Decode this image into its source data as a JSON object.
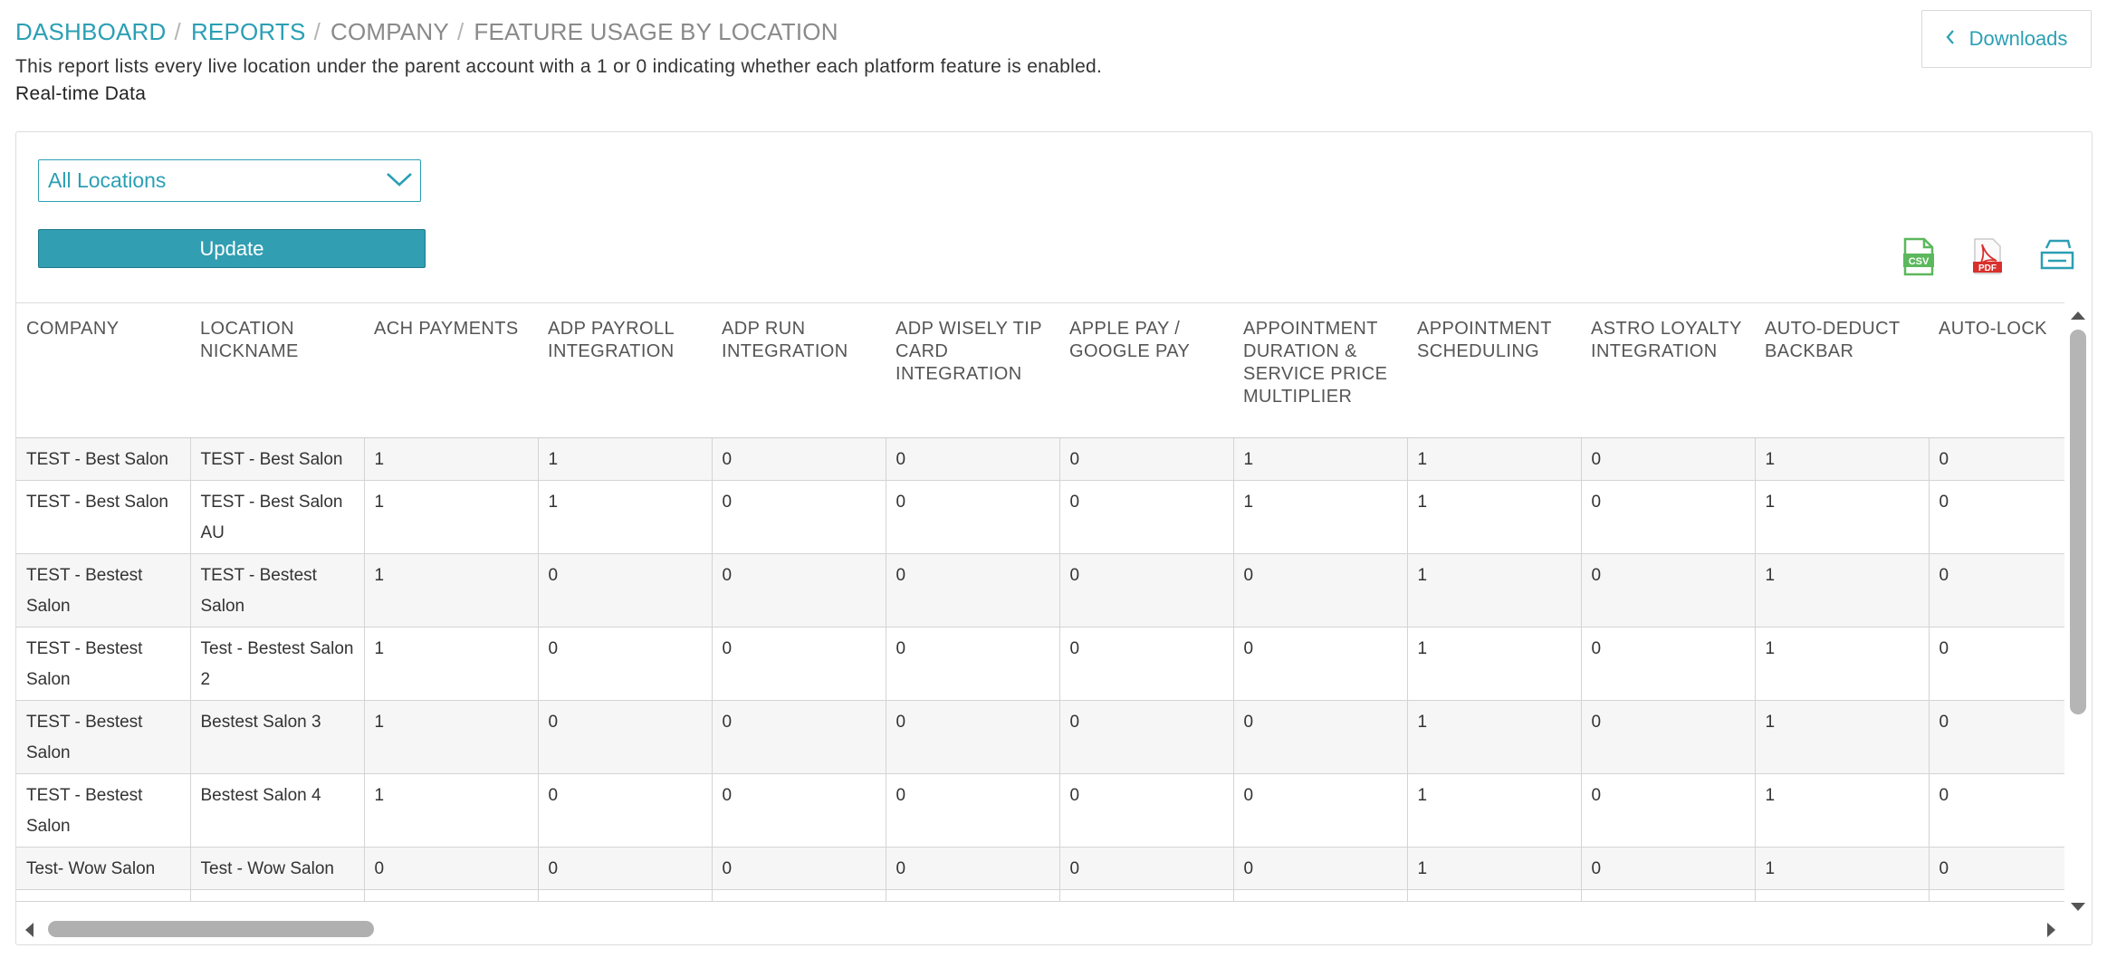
{
  "breadcrumb": {
    "items": [
      {
        "label": "DASHBOARD",
        "link": true
      },
      {
        "label": "REPORTS",
        "link": true
      },
      {
        "label": "COMPANY",
        "link": false
      },
      {
        "label": "FEATURE USAGE BY LOCATION",
        "link": false
      }
    ],
    "separator": "/"
  },
  "description": "This report lists every live location under the parent account with a 1 or 0 indicating whether each platform feature is enabled.",
  "data_mode": "Real-time Data",
  "downloads_button": {
    "label": "Downloads",
    "icon": "chevron-left-icon"
  },
  "filter": {
    "location_select_value": "All Locations",
    "update_label": "Update"
  },
  "export_icons": [
    {
      "name": "csv-export-icon",
      "label": "CSV",
      "color": "#5cb85c"
    },
    {
      "name": "pdf-export-icon",
      "label": "PDF",
      "color": "#d9302c"
    },
    {
      "name": "print-icon",
      "label": "",
      "color": "#2b9fb4"
    }
  ],
  "table": {
    "columns": [
      "COMPANY",
      "LOCATION NICKNAME",
      "ACH PAYMENTS",
      "ADP PAYROLL INTEGRATION",
      "ADP RUN INTEGRATION",
      "ADP WISELY TIP CARD INTEGRATION",
      "APPLE PAY / GOOGLE PAY",
      "APPOINTMENT DURATION & SERVICE PRICE MULTIPLIER",
      "APPOINTMENT SCHEDULING",
      "ASTRO LOYALTY INTEGRATION",
      "AUTO-DEDUCT BACKBAR",
      "AUTO-LOCK"
    ],
    "rows": [
      [
        "TEST - Best Salon",
        "TEST - Best Salon",
        "1",
        "1",
        "0",
        "0",
        "0",
        "1",
        "1",
        "0",
        "1",
        "0"
      ],
      [
        "TEST - Best Salon",
        "TEST - Best Salon AU",
        "1",
        "1",
        "0",
        "0",
        "0",
        "1",
        "1",
        "0",
        "1",
        "0"
      ],
      [
        "TEST - Bestest Salon",
        "TEST - Bestest Salon",
        "1",
        "0",
        "0",
        "0",
        "0",
        "0",
        "1",
        "0",
        "1",
        "0"
      ],
      [
        "TEST - Bestest Salon",
        "Test - Bestest Salon 2",
        "1",
        "0",
        "0",
        "0",
        "0",
        "0",
        "1",
        "0",
        "1",
        "0"
      ],
      [
        "TEST - Bestest Salon",
        "Bestest Salon 3",
        "1",
        "0",
        "0",
        "0",
        "0",
        "0",
        "1",
        "0",
        "1",
        "0"
      ],
      [
        "TEST - Bestest Salon",
        "Bestest Salon 4",
        "1",
        "0",
        "0",
        "0",
        "0",
        "0",
        "1",
        "0",
        "1",
        "0"
      ],
      [
        "Test- Wow Salon",
        "Test - Wow Salon",
        "0",
        "0",
        "0",
        "0",
        "0",
        "0",
        "1",
        "0",
        "1",
        "0"
      ],
      [
        "",
        "",
        "",
        "",
        "",
        "",
        "",
        "",
        "",
        "",
        "",
        ""
      ]
    ]
  },
  "colors": {
    "accent": "#2b9fb4",
    "button": "#319eb2",
    "row_alt": "#f6f6f6"
  }
}
